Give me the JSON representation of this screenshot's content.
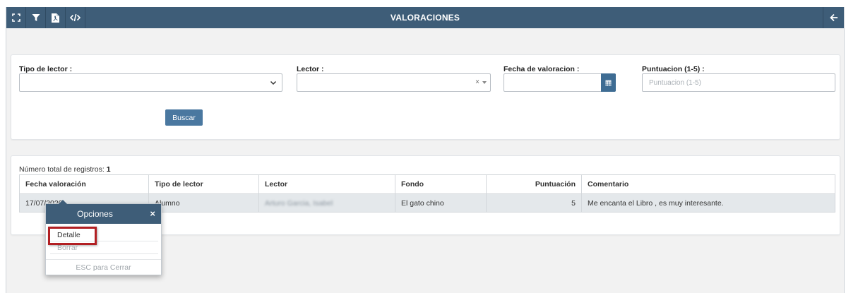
{
  "header": {
    "title": "VALORACIONES",
    "tools": [
      {
        "icon": "expand-icon"
      },
      {
        "icon": "filter-icon"
      },
      {
        "icon": "pdf-icon"
      },
      {
        "icon": "code-icon"
      }
    ],
    "back_icon": "arrow-left-icon",
    "color": "#3e5d78"
  },
  "filters": {
    "tipo_lector": {
      "label": "Tipo de lector :",
      "value": ""
    },
    "lector": {
      "label": "Lector :",
      "value": "",
      "clear": "×"
    },
    "fecha": {
      "label": "Fecha de valoracion :",
      "value": ""
    },
    "puntuacion": {
      "label": "Puntuacion (1-5) :",
      "placeholder": "Puntuacion (1-5)"
    },
    "buscar_label": "Buscar"
  },
  "results": {
    "total_label": "Número total de registros:",
    "total_count": "1",
    "columns": [
      "Fecha valoración",
      "Tipo de lector",
      "Lector",
      "Fondo",
      "Puntuación",
      "Comentario"
    ],
    "rows": [
      {
        "fecha": "17/07/2020",
        "tipo": "Alumno",
        "lector": "Arturo Garcia, Isabel",
        "fondo": "El gato chino",
        "puntuacion": "5",
        "comentario": "Me encanta el Libro , es muy interesante."
      }
    ]
  },
  "popup": {
    "title": "Opciones",
    "close": "×",
    "options": [
      "Detalle",
      "Borrar"
    ],
    "esc_label": "ESC para Cerrar"
  },
  "colors": {
    "accent": "#3e5d78",
    "button": "#4a78a0",
    "highlight": "#b21f23"
  }
}
